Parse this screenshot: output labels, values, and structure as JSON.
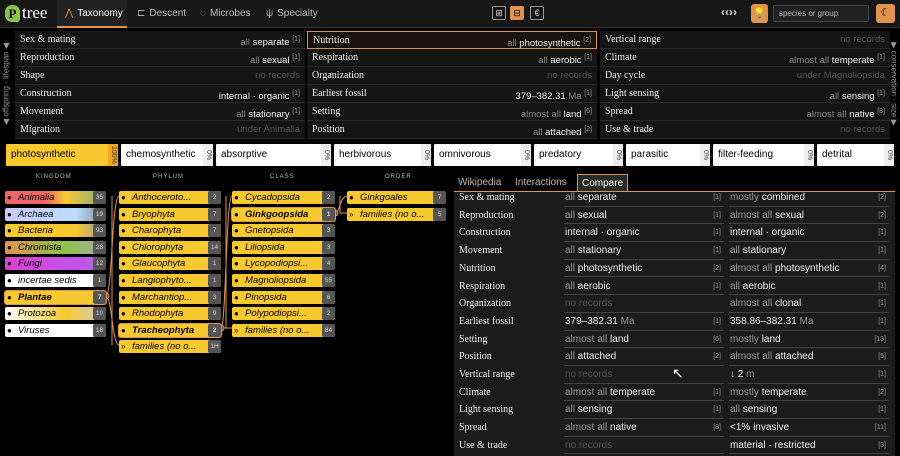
{
  "app": {
    "logo": "tree"
  },
  "nav": [
    {
      "label": "Taxonomy",
      "icon": "⋀"
    },
    {
      "label": "Descent",
      "icon": "⊏"
    },
    {
      "label": "Microbes",
      "icon": "◌"
    },
    {
      "label": "Specialty",
      "icon": "ψ"
    }
  ],
  "view_buttons": [
    "⊞",
    "⊟",
    "€"
  ],
  "quote_icon": "‹‹››",
  "search": {
    "placeholder": "species or group"
  },
  "side": {
    "left": "◀ offspring · lifespan ◀",
    "right": "▶ conservation · size ▶"
  },
  "traits_left": [
    {
      "key": "Sex & mating",
      "q": "all",
      "v": "separate",
      "n": "[1]"
    },
    {
      "key": "Reproduction",
      "q": "all",
      "v": "sexual",
      "n": "[1]"
    },
    {
      "key": "Shape",
      "q": "",
      "v": "",
      "nr": "no records"
    },
    {
      "key": "Construction",
      "q": "",
      "v": "internal · organic",
      "n": "[1]"
    },
    {
      "key": "Movement",
      "q": "all",
      "v": "stationary",
      "n": "[1]"
    },
    {
      "key": "Migration",
      "q": "",
      "v": "",
      "nr": "under Animalia"
    }
  ],
  "traits_mid": [
    {
      "key": "Nutrition",
      "q": "all",
      "v": "photosynthetic",
      "n": "[2]"
    },
    {
      "key": "Respiration",
      "q": "all",
      "v": "aerobic",
      "n": "[1]"
    },
    {
      "key": "Organization",
      "q": "",
      "v": "",
      "nr": "no records"
    },
    {
      "key": "Earliest fossil",
      "q": "",
      "v": "379–382.31",
      "u": "Ma",
      "n": "[1]"
    },
    {
      "key": "Setting",
      "q": "almost all",
      "v": "land",
      "n": "[6]"
    },
    {
      "key": "Position",
      "q": "all",
      "v": "attached",
      "n": "[2]"
    }
  ],
  "traits_right": [
    {
      "key": "Vertical range",
      "q": "",
      "v": "",
      "nr": "no records"
    },
    {
      "key": "Climate",
      "q": "almost all",
      "v": "temperate",
      "n": "[1]"
    },
    {
      "key": "Day cycle",
      "q": "",
      "v": "",
      "nr": "under Magnoliopsida"
    },
    {
      "key": "Light sensing",
      "q": "all",
      "v": "sensing",
      "n": "[1]"
    },
    {
      "key": "Spread",
      "q": "almost all",
      "v": "native",
      "n": "[8]"
    },
    {
      "key": "Use & trade",
      "q": "",
      "v": "",
      "nr": "no records"
    }
  ],
  "chips": [
    {
      "label": "photosynthetic",
      "pct": "100%"
    },
    {
      "label": "chemosynthetic",
      "pct": "0%"
    },
    {
      "label": "absorptive",
      "pct": "0%"
    },
    {
      "label": "herbivorous",
      "pct": "0%"
    },
    {
      "label": "omnivorous",
      "pct": "0%"
    },
    {
      "label": "predatory",
      "pct": "0%"
    },
    {
      "label": "parasitic",
      "pct": "0%"
    },
    {
      "label": "filter-feeding",
      "pct": "0%"
    },
    {
      "label": "detrital",
      "pct": "0%"
    }
  ],
  "columns": [
    "KINGDOM",
    "PHYLUM",
    "CLASS",
    "ORDER"
  ],
  "kingdoms": [
    {
      "name": "Animalia",
      "count": "35"
    },
    {
      "name": "Archaea",
      "count": "19"
    },
    {
      "name": "Bacteria",
      "count": "93"
    },
    {
      "name": "Chromista",
      "count": "28"
    },
    {
      "name": "Fungi",
      "count": "12"
    },
    {
      "name": "incertae sedis",
      "count": "1"
    },
    {
      "name": "Plantae",
      "count": "7"
    },
    {
      "name": "Protozoa",
      "count": "10"
    },
    {
      "name": "Viruses",
      "count": "18"
    }
  ],
  "phyla": [
    {
      "name": "Anthocerotophyta",
      "display": "Anthoceroto...",
      "count": "2"
    },
    {
      "name": "Bryophyta",
      "count": "7"
    },
    {
      "name": "Charophyta",
      "count": "7"
    },
    {
      "name": "Chlorophyta",
      "count": "14"
    },
    {
      "name": "Glaucophyta",
      "count": "1"
    },
    {
      "name": "Langiophyta",
      "display": "Langiophyto...",
      "count": "1"
    },
    {
      "name": "Marchantiophyta",
      "display": "Marchantiop...",
      "count": "3"
    },
    {
      "name": "Rhodophyta",
      "count": "9"
    },
    {
      "name": "Tracheophyta",
      "count": "2"
    },
    {
      "name": "families (no o...",
      "count": "1H"
    }
  ],
  "classes": [
    {
      "name": "Cycadopsida",
      "count": "2"
    },
    {
      "name": "Ginkgoopsida",
      "count": "1"
    },
    {
      "name": "Gnetopsida",
      "count": "3"
    },
    {
      "name": "Liliopsida",
      "count": "3"
    },
    {
      "name": "Lycopodiopsida",
      "display": "Lycopodiopsi...",
      "count": "4"
    },
    {
      "name": "Magnoliopsida",
      "count": "55"
    },
    {
      "name": "Pinopsida",
      "count": "6"
    },
    {
      "name": "Polypodiopsida",
      "display": "Polypodiopsi...",
      "count": "2"
    },
    {
      "name": "families (no o...",
      "count": "84"
    }
  ],
  "orders": [
    {
      "name": "Ginkgoales",
      "count": "7"
    },
    {
      "name": "families (no o...",
      "count": "5"
    }
  ],
  "tabs": [
    "Wikipedia",
    "Interactions",
    "Compare"
  ],
  "compare": [
    {
      "key": "Sex & mating",
      "a": {
        "q": "all",
        "v": "separate",
        "n": "[1]"
      },
      "b": {
        "q": "mostly",
        "v": "combined",
        "n": "[2]"
      }
    },
    {
      "key": "Reproduction",
      "a": {
        "q": "all",
        "v": "sexual",
        "n": "[1]"
      },
      "b": {
        "q": "almost all",
        "v": "sexual",
        "n": "[2]"
      }
    },
    {
      "key": "Construction",
      "a": {
        "q": "",
        "v": "internal · organic",
        "n": "[1]"
      },
      "b": {
        "q": "",
        "v": "internal · organic",
        "n": "[1]"
      }
    },
    {
      "key": "Movement",
      "a": {
        "q": "all",
        "v": "stationary",
        "n": "[1]"
      },
      "b": {
        "q": "all",
        "v": "stationary",
        "n": "[1]"
      }
    },
    {
      "key": "Nutrition",
      "a": {
        "q": "all",
        "v": "photosynthetic",
        "n": "[2]"
      },
      "b": {
        "q": "almost all",
        "v": "photosynthetic",
        "n": "[4]"
      }
    },
    {
      "key": "Respiration",
      "a": {
        "q": "all",
        "v": "aerobic",
        "n": "[1]"
      },
      "b": {
        "q": "all",
        "v": "aerobic",
        "n": "[1]"
      }
    },
    {
      "key": "Organization",
      "a": {
        "nr": "no records"
      },
      "b": {
        "q": "almost all",
        "v": "clonal",
        "n": "[1]"
      }
    },
    {
      "key": "Earliest fossil",
      "a": {
        "q": "",
        "v": "379–382.31",
        "u": "Ma",
        "n": "[1]"
      },
      "b": {
        "q": "",
        "v": "358.86–382.31",
        "u": "Ma",
        "n": "[1]"
      }
    },
    {
      "key": "Setting",
      "a": {
        "q": "almost all",
        "v": "land",
        "n": "[6]"
      },
      "b": {
        "q": "mostly",
        "v": "land",
        "n": "[13]"
      }
    },
    {
      "key": "Position",
      "a": {
        "q": "all",
        "v": "attached",
        "n": "[2]"
      },
      "b": {
        "q": "almost all",
        "v": "attached",
        "n": "[5]"
      }
    },
    {
      "key": "Vertical range",
      "a": {
        "nr": "no records"
      },
      "b": {
        "q": "",
        "v": "↓ 2",
        "u": "m",
        "n": "[1]"
      }
    },
    {
      "key": "Climate",
      "a": {
        "q": "almost all",
        "v": "temperate",
        "n": "[1]"
      },
      "b": {
        "q": "mostly",
        "v": "temperate",
        "n": "[2]"
      }
    },
    {
      "key": "Light sensing",
      "a": {
        "q": "all",
        "v": "sensing",
        "n": "[1]"
      },
      "b": {
        "q": "all",
        "v": "sensing",
        "n": "[1]"
      }
    },
    {
      "key": "Spread",
      "a": {
        "q": "almost all",
        "v": "native",
        "n": "[8]"
      },
      "b": {
        "q": "",
        "v": "<1% invasive",
        "n": "[11]"
      }
    },
    {
      "key": "Use & trade",
      "a": {
        "nr": "no records"
      },
      "b": {
        "q": "",
        "v": "material · restricted",
        "n": "[3]"
      }
    }
  ],
  "colors": {
    "accent": "#e0944f",
    "selected": "#f7c92e",
    "chip": "#ffffff"
  }
}
